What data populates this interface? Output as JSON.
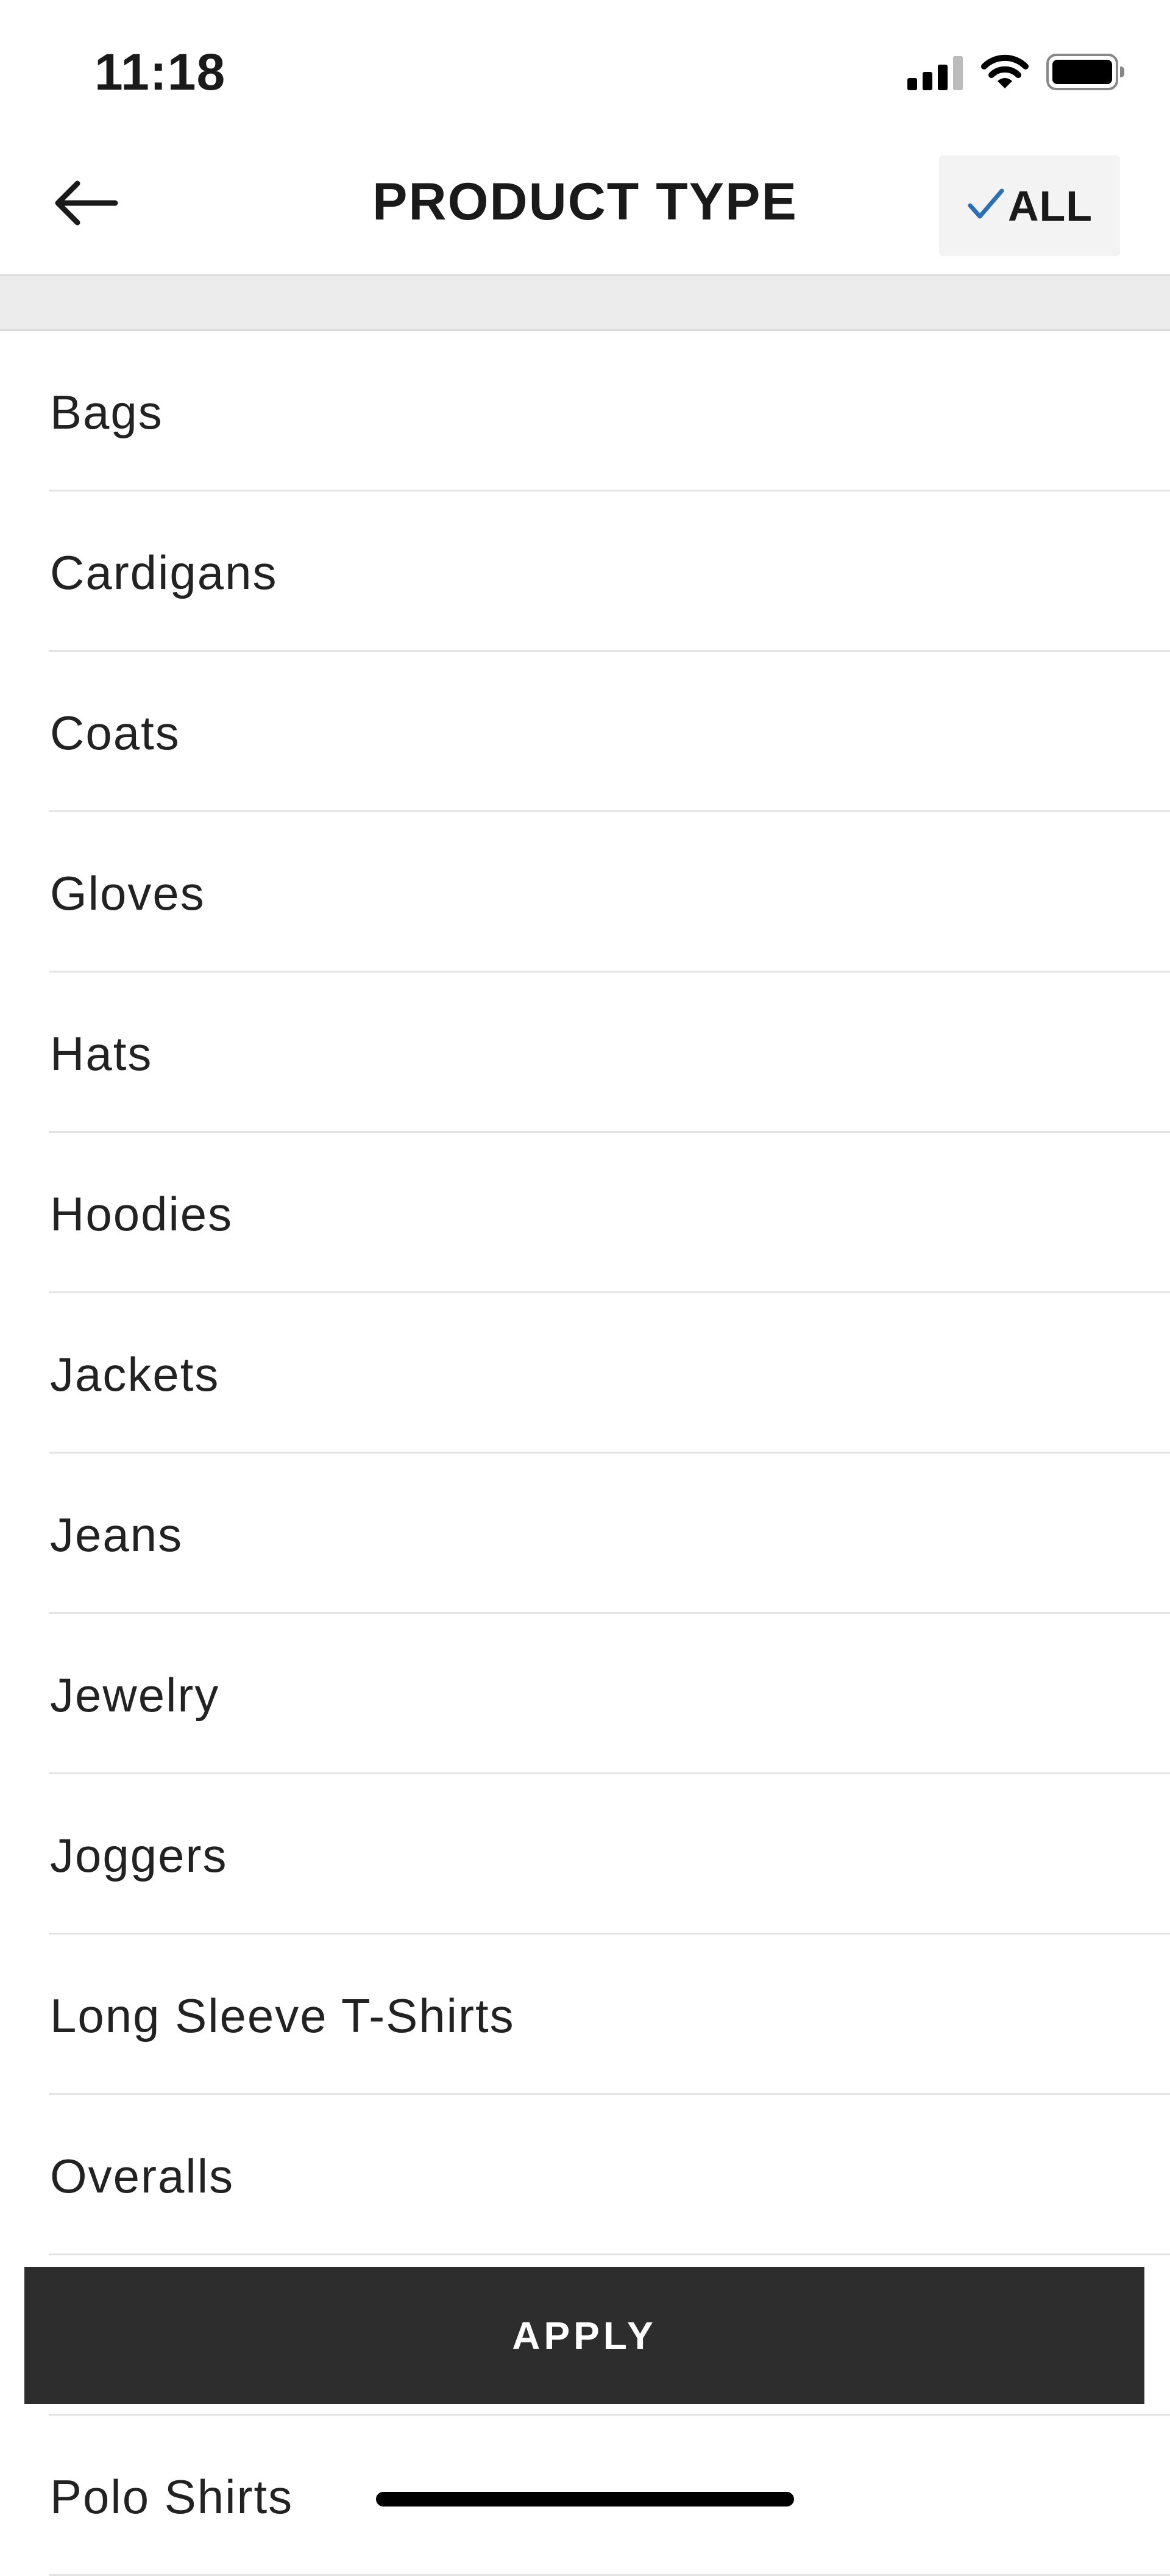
{
  "status_bar": {
    "time": "11:18",
    "icons": [
      "cellular-signal-icon",
      "wifi-icon",
      "battery-icon"
    ]
  },
  "header": {
    "back_icon": "arrow-left-icon",
    "title": "PRODUCT TYPE",
    "all_button": {
      "label": "ALL",
      "icon": "checkmark-icon",
      "check_color": "#2a6fb8"
    }
  },
  "list": {
    "items": [
      {
        "label": "Bags"
      },
      {
        "label": "Cardigans"
      },
      {
        "label": "Coats"
      },
      {
        "label": "Gloves"
      },
      {
        "label": "Hats"
      },
      {
        "label": "Hoodies"
      },
      {
        "label": "Jackets"
      },
      {
        "label": "Jeans"
      },
      {
        "label": "Jewelry"
      },
      {
        "label": "Joggers"
      },
      {
        "label": "Long Sleeve T-Shirts"
      },
      {
        "label": "Overalls"
      },
      {
        "label": ""
      },
      {
        "label": "Polo Shirts"
      }
    ]
  },
  "apply_button": {
    "label": "APPLY"
  },
  "colors": {
    "apply_background": "#2d2d2d",
    "header_band": "#ececec",
    "all_button_background": "#f3f3f3"
  }
}
